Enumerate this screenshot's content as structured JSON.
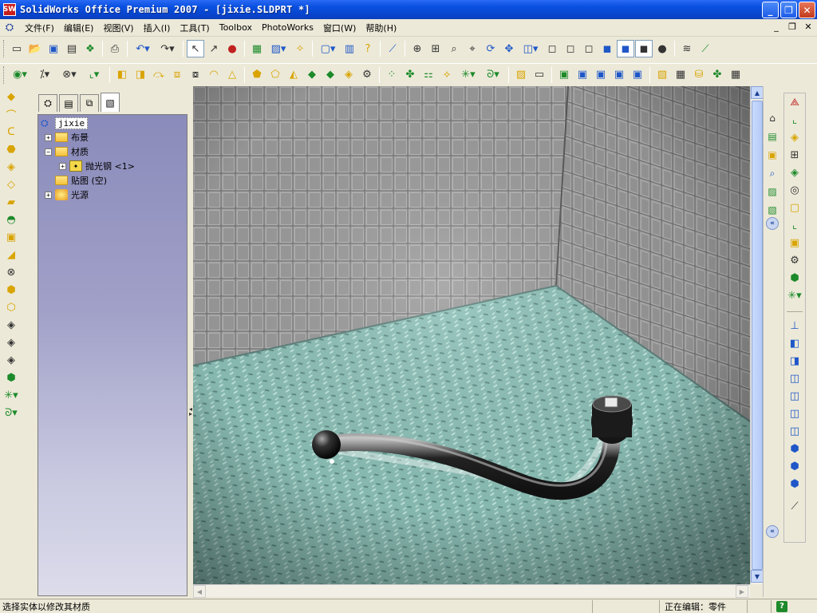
{
  "window": {
    "title": "SolidWorks Office Premium 2007 - [jixie.SLDPRT *]",
    "app_icon_text": "SW",
    "min_label": "_",
    "max_label": "❐",
    "close_label": "✕"
  },
  "menu": {
    "items": [
      "文件(F)",
      "编辑(E)",
      "视图(V)",
      "插入(I)",
      "工具(T)",
      "Toolbox",
      "PhotoWorks",
      "窗口(W)",
      "帮助(H)"
    ],
    "doc_controls": [
      "_",
      "❐",
      "✕"
    ]
  },
  "feature_manager": {
    "tabs": [
      "feature-tree",
      "property-manager",
      "configuration-manager",
      "photoworks-manager"
    ],
    "tree": {
      "root": "jixie",
      "items": [
        {
          "label": "布景",
          "expander": "+"
        },
        {
          "label": "材质",
          "expander": "−"
        },
        {
          "label": "抛光钢 <1>",
          "expander": "+"
        },
        {
          "label": "贴图 (空)",
          "expander": ""
        },
        {
          "label": "光源",
          "expander": "+"
        }
      ]
    }
  },
  "scrollbars": {
    "up": "▲",
    "down": "▼",
    "left": "◀",
    "right": "▶"
  },
  "taskpane": {
    "collapse_label": "«"
  },
  "statusbar": {
    "message": "选择实体以修改其材质",
    "editing": "正在编辑：零件",
    "help": "?"
  },
  "colors": {
    "titlebar": "#0a50e0",
    "tree_bg": "#a0a0c8",
    "floor": "#8fc4bc",
    "wall": "#9a9a9a"
  }
}
